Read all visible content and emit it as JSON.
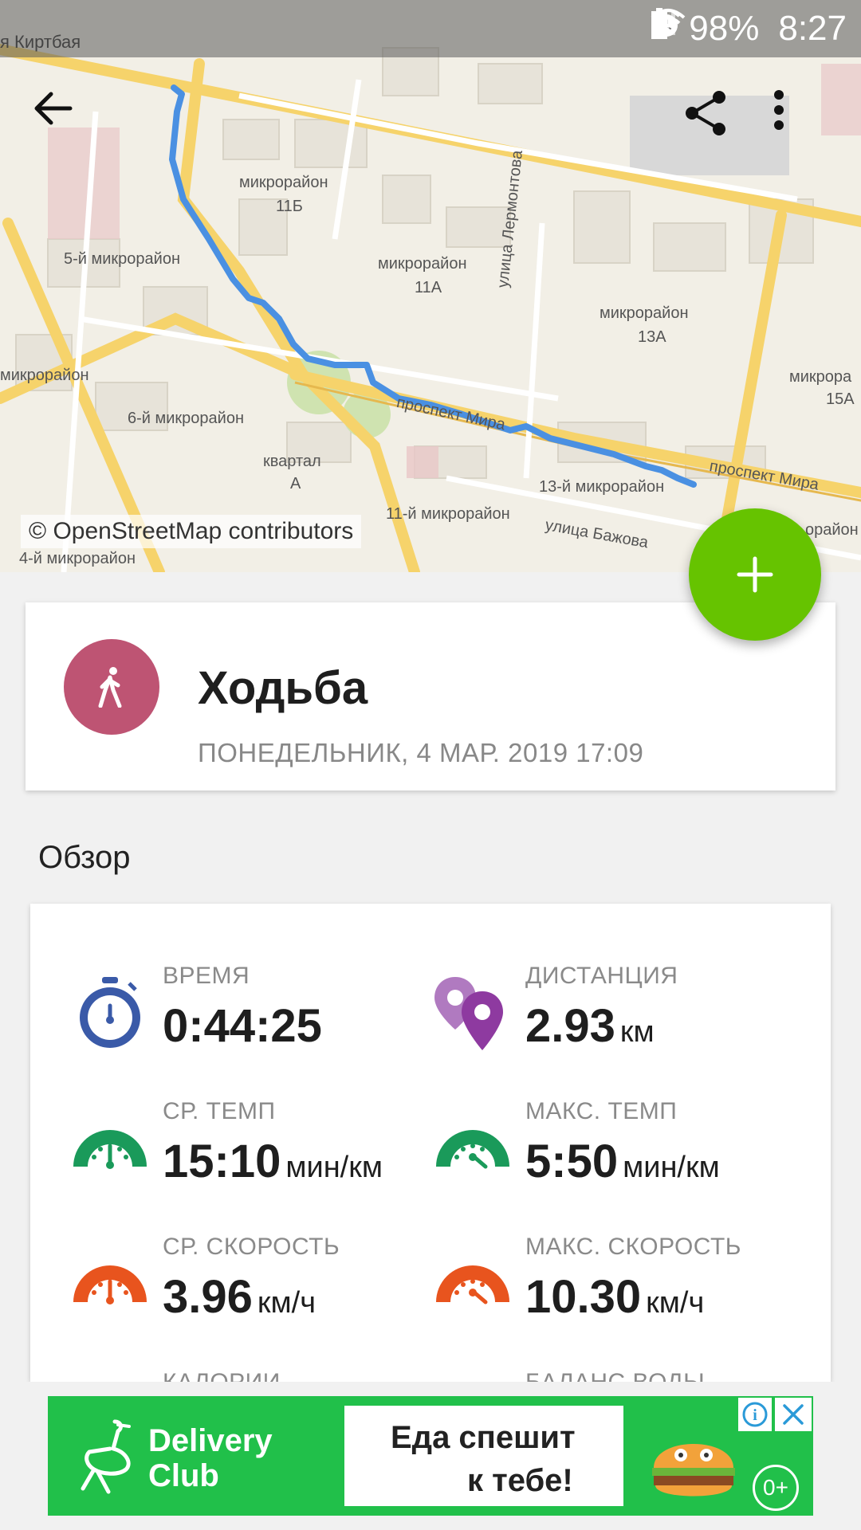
{
  "status_bar": {
    "corner_text": "я Киртбая",
    "battery": "98%",
    "time": "8:27"
  },
  "map": {
    "attribution": "© OpenStreetMap contributors",
    "labels": [
      "микрорайон",
      "11Б",
      "5-й микрорайон",
      "микрорайон",
      "11А",
      "улица Лермонтова",
      "микрорайон",
      "13А",
      "микрорайон",
      "6-й микрорайон",
      "проспект Мира",
      "квартал",
      "А",
      "13-й микрорайон",
      "проспект Мира",
      "11-й микрорайон",
      "улица Бажова",
      "4-й микрорайон",
      "микрора",
      "15А",
      "орайон"
    ]
  },
  "activity": {
    "title": "Ходьба",
    "date": "ПОНЕДЕЛЬНИК, 4 МАР. 2019 17:09",
    "icon": "walking-person-icon",
    "color": "#be5473"
  },
  "overview": {
    "title": "Обзор",
    "stats": [
      {
        "label": "ВРЕМЯ",
        "value": "0:44:25",
        "unit": ""
      },
      {
        "label": "ДИСТАНЦИЯ",
        "value": "2.93",
        "unit": "км"
      },
      {
        "label": "СР. ТЕМП",
        "value": "15:10",
        "unit": "мин/км"
      },
      {
        "label": "МАКС. ТЕМП",
        "value": "5:50",
        "unit": "мин/км"
      },
      {
        "label": "СР. СКОРОСТЬ",
        "value": "3.96",
        "unit": "км/ч"
      },
      {
        "label": "МАКС. СКОРОСТЬ",
        "value": "10.30",
        "unit": "км/ч"
      },
      {
        "label": "КАЛОРИИ",
        "value": "",
        "unit": ""
      },
      {
        "label": "БАЛАНС ВОДЫ",
        "value": "",
        "unit": ""
      }
    ]
  },
  "ad": {
    "brand_line1": "Delivery",
    "brand_line2": "Club",
    "slogan_line1": "Еда спешит",
    "slogan_line2": "к тебе!",
    "age": "0+",
    "info": "i"
  },
  "colors": {
    "accent_green": "#66c300",
    "route_blue": "#4a90e2",
    "time_icon": "#3a5aa8",
    "distance_icon": "#8e3aa0",
    "pace_icon": "#1a9a5a",
    "speed_icon": "#e8541e"
  }
}
